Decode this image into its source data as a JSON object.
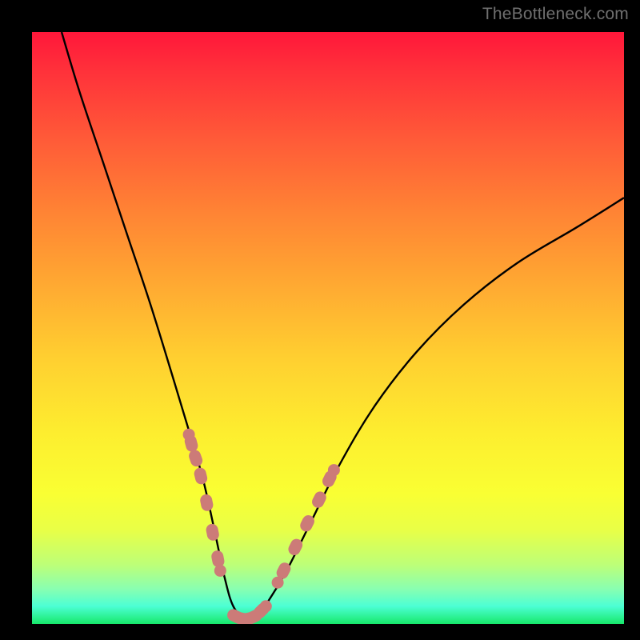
{
  "attribution": "TheBottleneck.com",
  "chart_data": {
    "type": "line",
    "title": "",
    "xlabel": "",
    "ylabel": "",
    "ylim": [
      0,
      100
    ],
    "xlim": [
      0,
      100
    ],
    "series": [
      {
        "name": "bottleneck-curve",
        "x": [
          5,
          8,
          12,
          16,
          20,
          24,
          27,
          29,
          31,
          32.5,
          34,
          36,
          38,
          40,
          43,
          47,
          52,
          58,
          65,
          73,
          82,
          92,
          100
        ],
        "y": [
          100,
          90,
          78,
          66,
          54,
          41,
          31,
          24,
          15,
          8,
          3,
          1,
          1,
          4,
          9,
          17,
          27,
          37,
          46,
          54,
          61,
          67,
          72
        ]
      },
      {
        "name": "highlight-band-left",
        "x": [
          26.5,
          27.3,
          28.0,
          29.0,
          30.0,
          31.0,
          31.8
        ],
        "y": [
          32,
          29,
          27,
          23,
          18,
          13,
          9
        ]
      },
      {
        "name": "highlight-band-bottom",
        "x": [
          34.0,
          35.0,
          36.0,
          37.0,
          38.0,
          39.5
        ],
        "y": [
          1.5,
          1.0,
          0.8,
          1.0,
          1.5,
          3.0
        ]
      },
      {
        "name": "highlight-band-right",
        "x": [
          41.5,
          43.5,
          45.5,
          47.5,
          49.5,
          51.0
        ],
        "y": [
          7,
          11,
          15,
          19,
          23,
          26
        ]
      }
    ],
    "gradient_stops": [
      {
        "pos": 0,
        "color": "#ff173a"
      },
      {
        "pos": 6,
        "color": "#ff2f3a"
      },
      {
        "pos": 18,
        "color": "#ff5a38"
      },
      {
        "pos": 30,
        "color": "#ff8234"
      },
      {
        "pos": 42,
        "color": "#ffa732"
      },
      {
        "pos": 55,
        "color": "#ffcf30"
      },
      {
        "pos": 68,
        "color": "#fdee2f"
      },
      {
        "pos": 78,
        "color": "#f9ff33"
      },
      {
        "pos": 84,
        "color": "#e9ff46"
      },
      {
        "pos": 90,
        "color": "#bdff78"
      },
      {
        "pos": 94,
        "color": "#8affb0"
      },
      {
        "pos": 97,
        "color": "#4cffd4"
      },
      {
        "pos": 100,
        "color": "#17e86a"
      }
    ],
    "colors": {
      "curve": "#000000",
      "highlight": "#cc7b78",
      "background_frame": "#000000"
    }
  }
}
